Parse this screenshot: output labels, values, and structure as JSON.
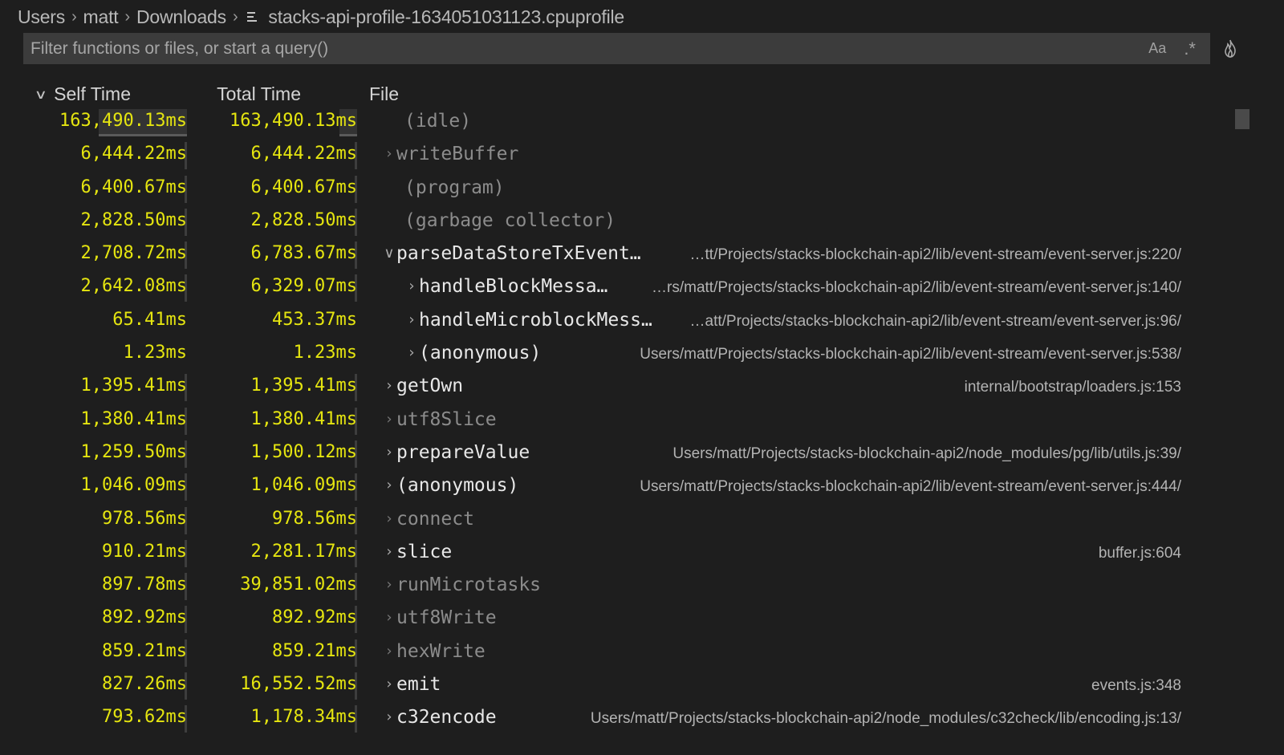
{
  "breadcrumb": {
    "items": [
      "Users",
      "matt",
      "Downloads"
    ],
    "file_icon": "file-lines-icon",
    "file": "stacks-api-profile-1634051031123.cpuprofile",
    "separator_icon": "chevron-right-icon"
  },
  "filter": {
    "placeholder": "Filter functions or files, or start a query()",
    "value": "",
    "match_case_label": "Aa",
    "regex_label": ".*",
    "flame_icon": "flame-icon"
  },
  "columns": {
    "self": "Self Time",
    "total": "Total Time",
    "file": "File",
    "sort_icon": "chevron-down-icon"
  },
  "rows": [
    {
      "self": "163,490.13ms",
      "total": "163,490.13ms",
      "fn": "(idle)",
      "file": "",
      "expandable": false,
      "expanded": false,
      "depth": 0,
      "dim": true,
      "self_impact": 0.65,
      "total_impact": 0.13
    },
    {
      "self": "6,444.22ms",
      "total": "6,444.22ms",
      "fn": "writeBuffer",
      "file": "",
      "expandable": true,
      "expanded": false,
      "depth": 0,
      "dim": true,
      "self_impact": 0.02,
      "total_impact": 0.01
    },
    {
      "self": "6,400.67ms",
      "total": "6,400.67ms",
      "fn": "(program)",
      "file": "",
      "expandable": false,
      "expanded": false,
      "depth": 0,
      "dim": true,
      "self_impact": 0.02,
      "total_impact": 0.01
    },
    {
      "self": "2,828.50ms",
      "total": "2,828.50ms",
      "fn": "(garbage collector)",
      "file": "",
      "expandable": false,
      "expanded": false,
      "depth": 0,
      "dim": true,
      "self_impact": 0.015,
      "total_impact": 0.01
    },
    {
      "self": "2,708.72ms",
      "total": "6,783.67ms",
      "fn": "parseDataStoreTxEvent…",
      "file": "…tt/Projects/stacks-blockchain-api2/lib/event-stream/event-server.js:220/",
      "expandable": true,
      "expanded": true,
      "depth": 0,
      "dim": false,
      "self_impact": 0.015,
      "total_impact": 0.01
    },
    {
      "self": "2,642.08ms",
      "total": "6,329.07ms",
      "fn": "handleBlockMessa…",
      "file": "…rs/matt/Projects/stacks-blockchain-api2/lib/event-stream/event-server.js:140/",
      "expandable": true,
      "expanded": false,
      "depth": 1,
      "dim": false,
      "self_impact": 0.015,
      "total_impact": 0.01
    },
    {
      "self": "65.41ms",
      "total": "453.37ms",
      "fn": "handleMicroblockMess…",
      "file": "…att/Projects/stacks-blockchain-api2/lib/event-stream/event-server.js:96/",
      "expandable": true,
      "expanded": false,
      "depth": 1,
      "dim": false,
      "self_impact": 0,
      "total_impact": 0
    },
    {
      "self": "1.23ms",
      "total": "1.23ms",
      "fn": "(anonymous)",
      "file": "Users/matt/Projects/stacks-blockchain-api2/lib/event-stream/event-server.js:538/",
      "expandable": true,
      "expanded": false,
      "depth": 1,
      "dim": false,
      "self_impact": 0,
      "total_impact": 0
    },
    {
      "self": "1,395.41ms",
      "total": "1,395.41ms",
      "fn": "getOwn",
      "file": "internal/bootstrap/loaders.js:153",
      "expandable": true,
      "expanded": false,
      "depth": 0,
      "dim": false,
      "self_impact": 0.01,
      "total_impact": 0.005
    },
    {
      "self": "1,380.41ms",
      "total": "1,380.41ms",
      "fn": "utf8Slice",
      "file": "",
      "expandable": true,
      "expanded": false,
      "depth": 0,
      "dim": true,
      "self_impact": 0.01,
      "total_impact": 0.005
    },
    {
      "self": "1,259.50ms",
      "total": "1,500.12ms",
      "fn": "prepareValue",
      "file": "Users/matt/Projects/stacks-blockchain-api2/node_modules/pg/lib/utils.js:39/",
      "expandable": true,
      "expanded": false,
      "depth": 0,
      "dim": false,
      "self_impact": 0.01,
      "total_impact": 0.005
    },
    {
      "self": "1,046.09ms",
      "total": "1,046.09ms",
      "fn": "(anonymous)",
      "file": "Users/matt/Projects/stacks-blockchain-api2/lib/event-stream/event-server.js:444/",
      "expandable": true,
      "expanded": false,
      "depth": 0,
      "dim": false,
      "self_impact": 0.01,
      "total_impact": 0.005
    },
    {
      "self": "978.56ms",
      "total": "978.56ms",
      "fn": "connect",
      "file": "",
      "expandable": true,
      "expanded": false,
      "depth": 0,
      "dim": true,
      "self_impact": 0.005,
      "total_impact": 0.005
    },
    {
      "self": "910.21ms",
      "total": "2,281.17ms",
      "fn": "slice",
      "file": "buffer.js:604",
      "expandable": true,
      "expanded": false,
      "depth": 0,
      "dim": false,
      "self_impact": 0.005,
      "total_impact": 0.005
    },
    {
      "self": "897.78ms",
      "total": "39,851.02ms",
      "fn": "runMicrotasks",
      "file": "",
      "expandable": true,
      "expanded": false,
      "depth": 0,
      "dim": true,
      "self_impact": 0.005,
      "total_impact": 0.03
    },
    {
      "self": "892.92ms",
      "total": "892.92ms",
      "fn": "utf8Write",
      "file": "",
      "expandable": true,
      "expanded": false,
      "depth": 0,
      "dim": true,
      "self_impact": 0.005,
      "total_impact": 0.005
    },
    {
      "self": "859.21ms",
      "total": "859.21ms",
      "fn": "hexWrite",
      "file": "",
      "expandable": true,
      "expanded": false,
      "depth": 0,
      "dim": true,
      "self_impact": 0.005,
      "total_impact": 0.005
    },
    {
      "self": "827.26ms",
      "total": "16,552.52ms",
      "fn": "emit",
      "file": "events.js:348",
      "expandable": true,
      "expanded": false,
      "depth": 0,
      "dim": false,
      "self_impact": 0.005,
      "total_impact": 0.015
    },
    {
      "self": "793.62ms",
      "total": "1,178.34ms",
      "fn": "c32encode",
      "file": "Users/matt/Projects/stacks-blockchain-api2/node_modules/c32check/lib/encoding.js:13/",
      "expandable": true,
      "expanded": false,
      "depth": 0,
      "dim": false,
      "self_impact": 0.005,
      "total_impact": 0.005
    }
  ],
  "colors": {
    "background": "#1e1e1e",
    "time_text": "#e5e510",
    "fn_text": "#e8e8e8",
    "fn_dim_text": "#8c8c8c",
    "file_text": "#b3b3b3",
    "filter_bg": "#3c3c3c"
  }
}
